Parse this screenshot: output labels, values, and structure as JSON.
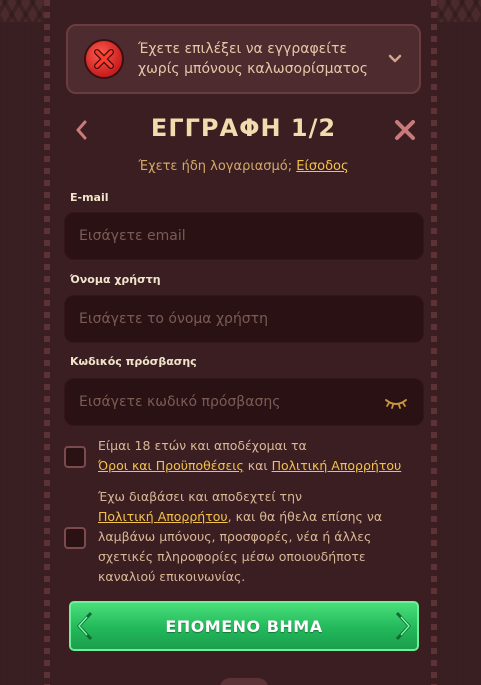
{
  "bonus": {
    "text": "Έχετε επιλέξει να εγγραφείτε χωρίς μπόνους καλωσορίσματος"
  },
  "header": {
    "title": "ΕΓΓΡΑΦΗ 1/2"
  },
  "login": {
    "prompt": "Έχετε ήδη λογαριασμό;",
    "link": "Είσοδος"
  },
  "form": {
    "email_label": "E-mail",
    "email_placeholder": "Εισάγετε email",
    "username_label": "Όνομα χρήστη",
    "username_placeholder": "Εισάγετε το όνομα χρήστη",
    "password_label": "Κωδικός πρόσβασης",
    "password_placeholder": "Εισάγετε κωδικό πρόσβασης"
  },
  "consent": {
    "age_prefix": "Είμαι",
    "age_number": "18",
    "age_suffix": "ετών και αποδέχομαι τα",
    "terms_link": "Όροι και Προϋποθέσεις",
    "and": "και",
    "privacy_link": "Πολιτική Απορρήτου",
    "marketing_prefix": "Έχω διαβάσει και αποδεχτεί την",
    "marketing_privacy_link": "Πολιτική Απορρήτου",
    "marketing_suffix": ", και θα ήθελα επίσης να λαμβάνω μπόνους, προσφορές, νέα ή άλλες σχετικές πληροφορίες μέσω οποιουδήποτε καναλιού επικοινωνίας."
  },
  "actions": {
    "next_label": "ΕΠΟΜΕΝΟ ΒΗΜΑ"
  },
  "colors": {
    "background": "#3a1f22",
    "accent_link": "#f3c24a",
    "title": "#f1dcae",
    "button_green": "#22b85a",
    "close_icon": "#c97a7a"
  }
}
